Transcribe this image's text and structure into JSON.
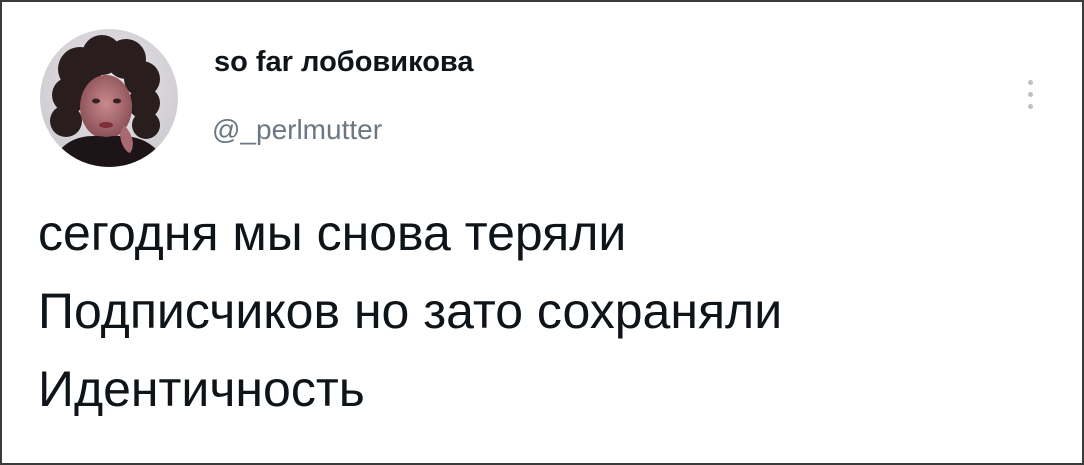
{
  "tweet": {
    "author": {
      "display_name": "so far лобовикова",
      "handle": "@_perlmutter",
      "avatar_icon": "profile-photo-avatar"
    },
    "more_icon": "vertical-ellipsis-icon",
    "text_lines": [
      "сегодня мы снова теряли",
      "Подписчиков но зато сохраняли",
      "Идентичность"
    ]
  },
  "colors": {
    "text_primary": "#0f1419",
    "text_secondary": "#6b7883",
    "background": "#ffffff",
    "border": "#3b3b3b"
  }
}
